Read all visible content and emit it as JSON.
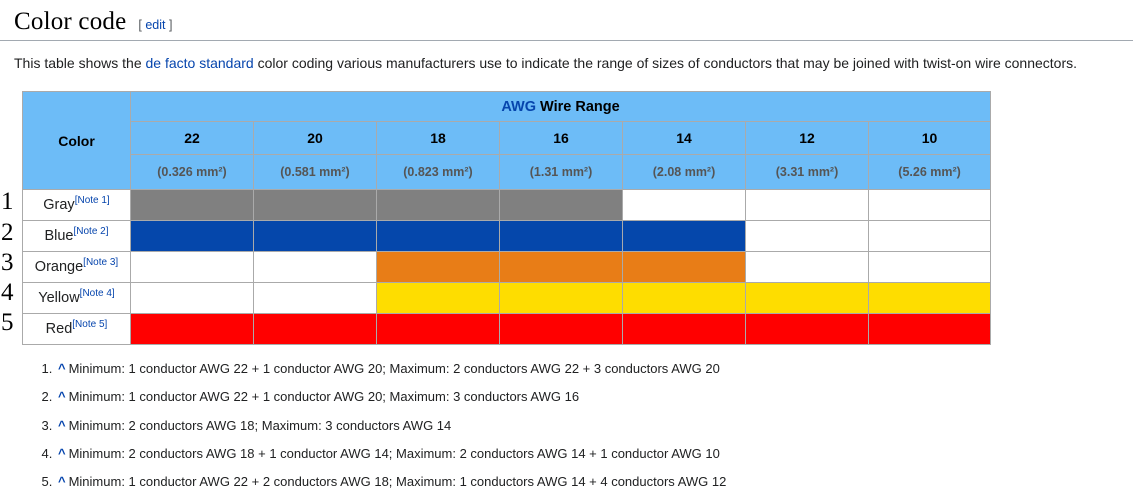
{
  "section": {
    "title": "Color code",
    "edit": {
      "open_bracket": "[",
      "label": "edit",
      "close_bracket": "]"
    }
  },
  "intro": {
    "part1": "This table shows the ",
    "link": "de facto standard",
    "part2": " color coding various manufacturers use to indicate the range of sizes of conductors that may be joined with twist-on wire connectors."
  },
  "table": {
    "color_header": "Color",
    "awg_link": "AWG",
    "range_header": " Wire Range",
    "gauges": [
      "22",
      "20",
      "18",
      "16",
      "14",
      "12",
      "10"
    ],
    "areas": [
      "(0.326 mm²)",
      "(0.581 mm²)",
      "(0.823 mm²)",
      "(1.31 mm²)",
      "(2.08 mm²)",
      "(3.31 mm²)",
      "(5.26 mm²)"
    ],
    "rows": [
      {
        "number": "1",
        "name": "Gray",
        "note": "[Note 1]",
        "hex": "#808080",
        "filled": [
          true,
          true,
          true,
          true,
          false,
          false,
          false
        ]
      },
      {
        "number": "2",
        "name": "Blue",
        "note": "[Note 2]",
        "hex": "#0547AB",
        "filled": [
          true,
          true,
          true,
          true,
          true,
          false,
          false
        ]
      },
      {
        "number": "3",
        "name": "Orange",
        "note": "[Note 3]",
        "hex": "#E87D17",
        "filled": [
          false,
          false,
          true,
          true,
          true,
          false,
          false
        ]
      },
      {
        "number": "4",
        "name": "Yellow",
        "note": "[Note 4]",
        "hex": "#FEDD00",
        "filled": [
          false,
          false,
          true,
          true,
          true,
          true,
          true
        ]
      },
      {
        "number": "5",
        "name": "Red",
        "note": "[Note 5]",
        "hex": "#FF0000",
        "filled": [
          true,
          true,
          true,
          true,
          true,
          true,
          true
        ]
      }
    ],
    "header_bg": "#6DBCF7",
    "link_color": "#0645AD"
  },
  "notes": [
    {
      "caret": "^",
      "text": "Minimum: 1 conductor AWG 22 + 1 conductor AWG 20; Maximum: 2 conductors AWG 22 + 3 conductors AWG 20"
    },
    {
      "caret": "^",
      "text": "Minimum: 1 conductor AWG 22 + 1 conductor AWG 20; Maximum: 3 conductors AWG 16"
    },
    {
      "caret": "^",
      "text": "Minimum: 2 conductors AWG 18; Maximum: 3 conductors AWG 14"
    },
    {
      "caret": "^",
      "text": "Minimum: 2 conductors AWG 18 + 1 conductor AWG 14; Maximum: 2 conductors AWG 14 + 1 conductor AWG 10"
    },
    {
      "caret": "^",
      "text": "Minimum: 1 conductor AWG 22 + 2 conductors AWG 18; Maximum: 1 conductors AWG 14 + 4 conductors AWG 12"
    }
  ]
}
